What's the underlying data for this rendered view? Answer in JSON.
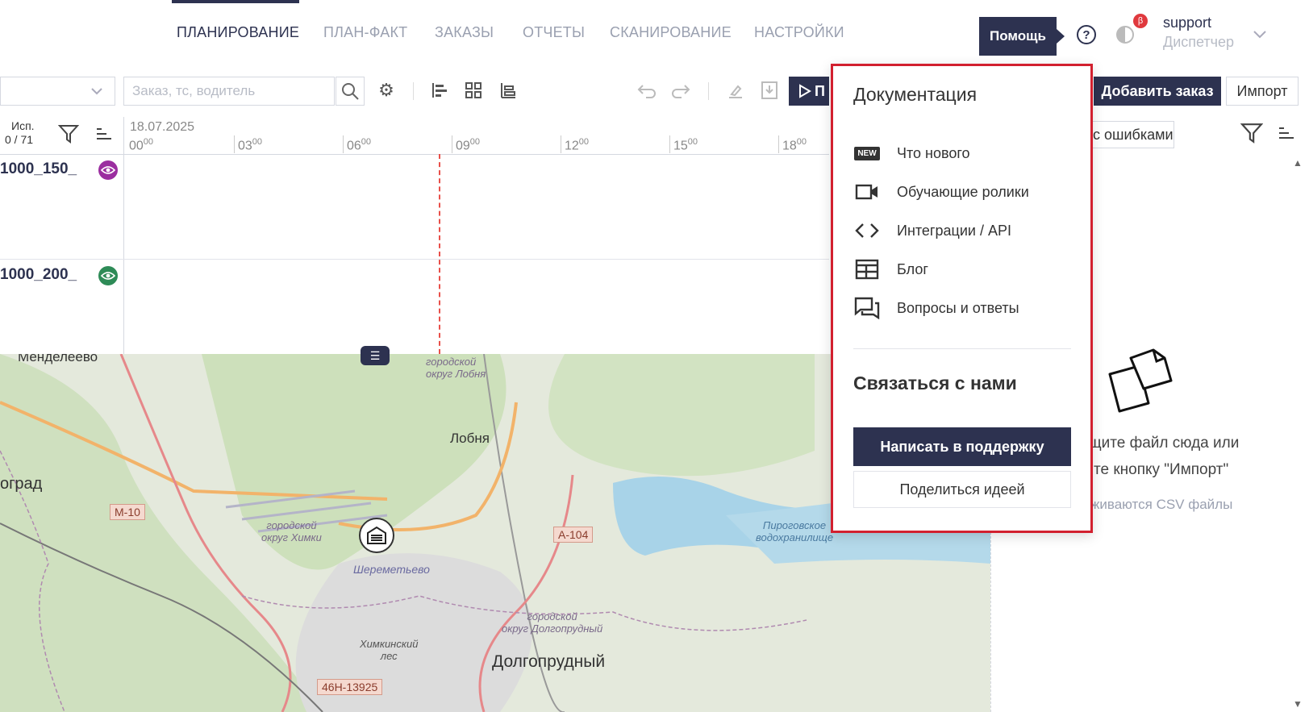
{
  "nav": {
    "items": [
      {
        "label": "ПЛАНИРОВАНИЕ",
        "active": true
      },
      {
        "label": "ПЛАН-ФАКТ"
      },
      {
        "label": "ЗАКАЗЫ"
      },
      {
        "label": "ОТЧЕТЫ"
      },
      {
        "label": "СКАНИРОВАНИЕ"
      },
      {
        "label": "НАСТРОЙКИ"
      }
    ]
  },
  "header": {
    "help_tooltip": "Помощь",
    "help_icon": "question-circle-icon",
    "beta_badge": "β",
    "user_name": "support",
    "user_role": "Диспетчер"
  },
  "toolbar": {
    "search_placeholder": "Заказ, тс, водитель",
    "run_label": "П",
    "add_order_label": "Добавить заказ",
    "import_label": "Импорт",
    "errors_filter_label": "с ошибками"
  },
  "timeline": {
    "col_header_line1": "Исп.",
    "col_header_line2": "0 / 71",
    "date": "18.07.2025",
    "ticks": [
      {
        "h": "00",
        "m": "00"
      },
      {
        "h": "03",
        "m": "00"
      },
      {
        "h": "06",
        "m": "00"
      },
      {
        "h": "09",
        "m": "00"
      },
      {
        "h": "12",
        "m": "00"
      },
      {
        "h": "15",
        "m": "00"
      },
      {
        "h": "18",
        "m": "00"
      }
    ],
    "rows": [
      {
        "label": "1000_150_",
        "eye_color": "#9b2ea0"
      },
      {
        "label": "1000_200_",
        "eye_color": "#2e8b57"
      }
    ]
  },
  "map": {
    "labels": {
      "mendeleevo": "Менделеево",
      "lobnya_okrug": "городской\nокруг Лобня",
      "lobnya": "Лобня",
      "ograd": "оград",
      "khimki_okrug": "городской\nокруг Химки",
      "sheremetyevo": "Шереметьево",
      "pirogovskoe": "Пироговское\nводохранилище",
      "dolgoprudny_okrug": "городской\nокруг Долгопрудный",
      "khimkinsky_les": "Химкинский\nлес",
      "dolgoprudny": "Долгопрудный"
    },
    "roads": {
      "m10": "М-10",
      "a104": "А-104",
      "r46n": "46Н-13925"
    }
  },
  "dropzone": {
    "line1": "щите файл сюда или",
    "line2": "те кнопку \"Импорт\"",
    "sub": "живаются CSV файлы"
  },
  "help_menu": {
    "docs_title": "Документация",
    "items": [
      {
        "label": "Что нового",
        "icon": "new-badge-icon"
      },
      {
        "label": "Обучающие ролики",
        "icon": "video-camera-icon"
      },
      {
        "label": "Интеграции / API",
        "icon": "code-brackets-icon"
      },
      {
        "label": "Блог",
        "icon": "blog-layout-icon"
      },
      {
        "label": "Вопросы и ответы",
        "icon": "chat-bubbles-icon"
      }
    ],
    "new_badge": "NEW",
    "contact_title": "Связаться с нами",
    "support_label": "Написать в поддержку",
    "idea_label": "Поделиться идеей"
  },
  "colors": {
    "primary": "#2d3250",
    "highlight": "#d2202f",
    "now_line": "#e8504a"
  }
}
